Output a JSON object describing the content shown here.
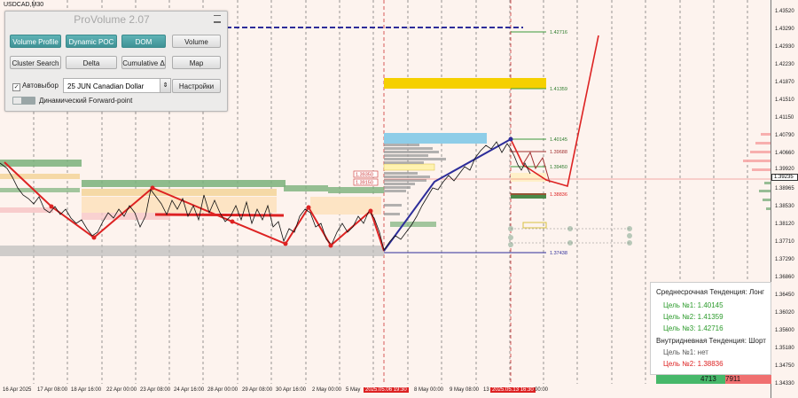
{
  "symbol": "USDCAD,M30",
  "panel": {
    "title": "ProVolume 2.07",
    "buttons": {
      "volume_profile": "Volume Profile",
      "dynamic_poc": "Dynamic POC",
      "dom": "DOM",
      "volume": "Volume",
      "cluster_search": "Cluster Search",
      "delta": "Delta",
      "cumulative_delta": "Cumulative Δ",
      "map": "Map",
      "settings": "Настройки"
    },
    "auto_select_label": "Автовыбор",
    "instrument_value": "25 JUN Canadian Dollar",
    "forward_point_label": "Динамический Forward-point"
  },
  "price_axis": {
    "ticks": [
      "1.43520",
      "1.43290",
      "1.42930",
      "1.42230",
      "1.41870",
      "1.41510",
      "1.41150",
      "1.40790",
      "1.40660",
      "1.40330",
      "1.39920",
      "1.39570",
      "1.39235",
      "1.38965",
      "1.38530",
      "1.38120",
      "1.37710",
      "1.37290",
      "1.36860",
      "1.36450",
      "1.36020",
      "1.35600",
      "1.35180",
      "1.34750",
      "1.34330"
    ],
    "current_price": "1.39235"
  },
  "level_labels": {
    "l1": "1.42716",
    "l2": "1.41359",
    "l3": "1.40145",
    "l4": "1.39688",
    "l5": "1.39450",
    "l6": "1.38836",
    "l7": "1.37438",
    "box_a": "1.39350",
    "box_b": "1.39150"
  },
  "time_axis": [
    "16 Apr 2025",
    "17 Apr 08:00",
    "18 Apr 16:00",
    "22 Apr 00:00",
    "23 Apr 08:00",
    "24 Apr 16:00",
    "28 Apr 00:00",
    "29 Apr 08:00",
    "30 Apr 16:00",
    "2 May 00:00",
    "5 May",
    "2025.05.06 19:30",
    "8 May 00:00",
    "9 May 08:00",
    "13",
    "2025.05.13 16:30",
    "00:00"
  ],
  "info": {
    "medium_trend": "Среднесрочная Тенденция: Лонг",
    "target1_label": "Цель №1:",
    "target1_value": "1.40145",
    "target2_label": "Цель №2:",
    "target2_value": "1.41359",
    "target3_label": "Цель №3:",
    "target3_value": "1.42716",
    "intraday_trend": "Внутридневная Тенденция: Шорт",
    "intraday_target1_label": "Цель №1:",
    "intraday_target1_value": "нет",
    "intraday_target2_label": "Цель №2:",
    "intraday_target2_value": "1.38836"
  },
  "volume_bar": {
    "left_value": "4713",
    "right_value": "7911"
  },
  "colors": {
    "background": "#fdf3ee",
    "panel_teal": "#4fa3a6",
    "long": "#2a9a2a",
    "short": "#d22"
  }
}
